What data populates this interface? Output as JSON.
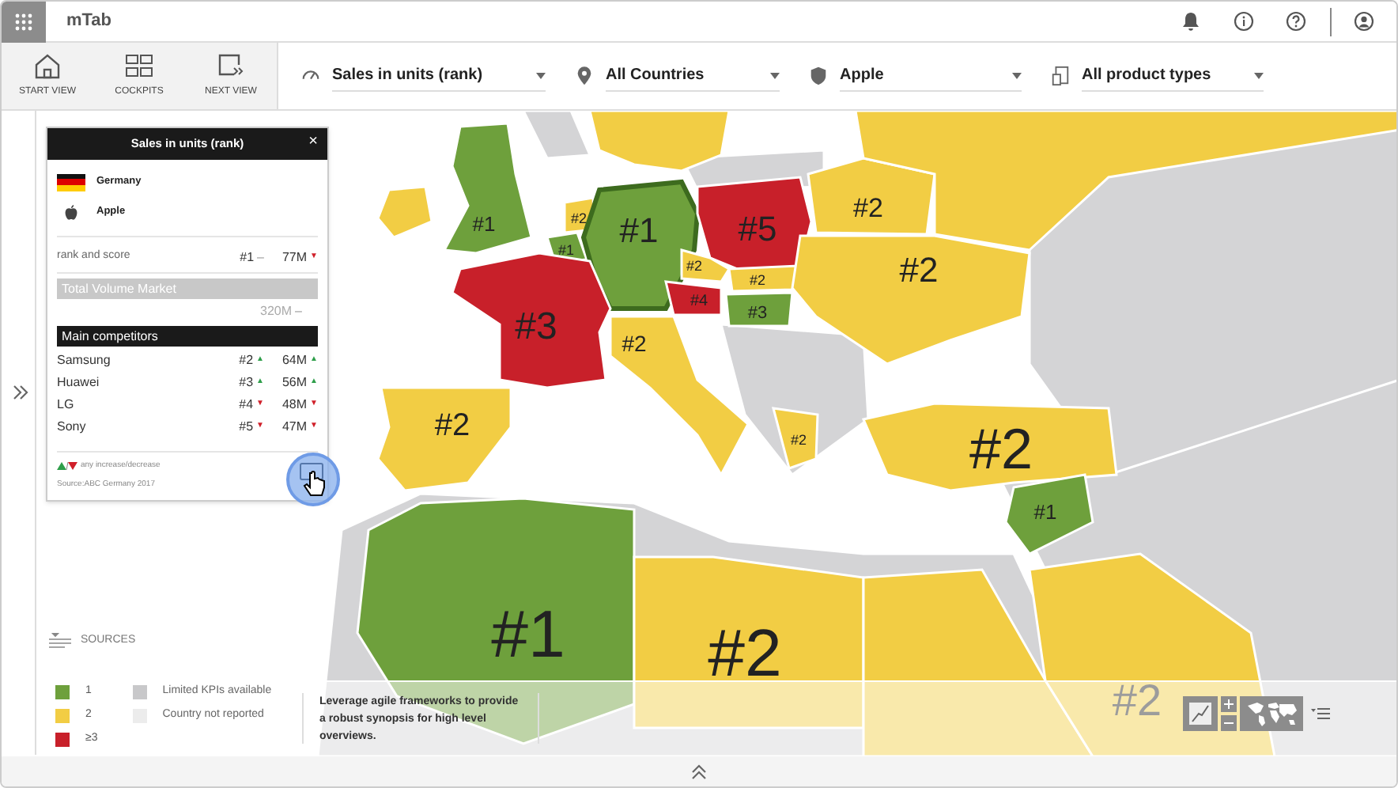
{
  "app": {
    "title": "mTab"
  },
  "views": [
    {
      "label": "START VIEW",
      "kind": "home"
    },
    {
      "label": "COCKPITS",
      "kind": "grid"
    },
    {
      "label": "NEXT VIEW",
      "kind": "next"
    }
  ],
  "filters": [
    {
      "label": "Sales in units (rank)",
      "kind": "gauge"
    },
    {
      "label": "All Countries",
      "kind": "pin"
    },
    {
      "label": "Apple",
      "kind": "shield"
    },
    {
      "label": "All product types",
      "kind": "product"
    }
  ],
  "info_panel": {
    "title": "Sales in units (rank)",
    "close": "×",
    "country": "Germany",
    "brand": "Apple",
    "score": {
      "label": "rank and score",
      "rank": "#1",
      "rank_trend": {
        "kind": "flat",
        "symbol": "–"
      },
      "value": "77M",
      "value_trend": {
        "kind": "down",
        "symbol": "▼"
      }
    },
    "total": {
      "label": "Total Volume Market",
      "value": "320M",
      "value_trend": {
        "kind": "flat",
        "symbol": "–"
      }
    },
    "competitors_title": "Main competitors",
    "competitors": [
      {
        "name": "Samsung",
        "rank": "#2",
        "rank_trend": {
          "kind": "up",
          "symbol": "▲"
        },
        "value": "64M",
        "value_trend": {
          "kind": "up",
          "symbol": "▲"
        }
      },
      {
        "name": "Huawei",
        "rank": "#3",
        "rank_trend": {
          "kind": "up",
          "symbol": "▲"
        },
        "value": "56M",
        "value_trend": {
          "kind": "up",
          "symbol": "▲"
        }
      },
      {
        "name": "LG",
        "rank": "#4",
        "rank_trend": {
          "kind": "down",
          "symbol": "▼"
        },
        "value": "48M",
        "value_trend": {
          "kind": "down",
          "symbol": "▼"
        }
      },
      {
        "name": "Sony",
        "rank": "#5",
        "rank_trend": {
          "kind": "down",
          "symbol": "▼"
        },
        "value": "47M",
        "value_trend": {
          "kind": "down",
          "symbol": "▼"
        }
      }
    ],
    "footnote": "any increase/decrease",
    "source": "Source:ABC Germany 2017"
  },
  "map": {
    "regions": [
      {
        "label": "#1",
        "color": "#6ea03c",
        "selected": false
      },
      {
        "color": "#f2cd44",
        "selected": false
      },
      {
        "color": "#f2cd44",
        "selected": false
      },
      {
        "label": "#2",
        "color": "#f2cd44",
        "selected": false
      },
      {
        "label": "#1",
        "color": "#6ea03c",
        "selected": false
      },
      {
        "label": "#1",
        "color": "#6ea03c",
        "selected": true
      },
      {
        "label": "#5",
        "color": "#c8202a",
        "selected": false
      },
      {
        "label": "#2",
        "color": "#f2cd44",
        "selected": false
      },
      {
        "label": "#2",
        "color": "#f2cd44",
        "selected": false
      },
      {
        "label": "#4",
        "color": "#c8202a",
        "selected": false
      },
      {
        "label": "#3",
        "color": "#6ea03c",
        "selected": false
      },
      {
        "label": "#3",
        "color": "#c8202a",
        "selected": false
      },
      {
        "label": "#2",
        "color": "#f2cd44",
        "selected": false
      },
      {
        "label": "#2",
        "color": "#f2cd44",
        "selected": false
      },
      {
        "label": "#2",
        "color": "#f2cd44",
        "selected": false
      },
      {
        "label": "#2",
        "color": "#f2cd44",
        "selected": false
      },
      {
        "label": "#2",
        "color": "#f2cd44",
        "selected": false
      },
      {
        "color": "#f2cd44",
        "selected": false
      },
      {
        "label": "#2",
        "color": "#f2cd44",
        "selected": false
      },
      {
        "label": "#1",
        "color": "#6ea03c",
        "selected": false
      },
      {
        "label": "#1",
        "color": "#6ea03c",
        "selected": false
      },
      {
        "label": "#2",
        "color": "#f2cd44",
        "selected": false
      },
      {
        "color": "#f2cd44",
        "selected": false
      },
      {
        "label": "#2",
        "color": "#f2cd44",
        "selected": false
      }
    ]
  },
  "legend": {
    "title": "SOURCES",
    "ranks": [
      {
        "label": "1",
        "color": "#6ea03c"
      },
      {
        "label": "2",
        "color": "#f2cd44"
      },
      {
        "label": "≥3",
        "color": "#c8202a"
      }
    ],
    "coverage": [
      {
        "label": "Limited KPIs available",
        "color": "#c8c8ca"
      },
      {
        "label": "Country not reported",
        "color": "#ececec"
      }
    ]
  },
  "note": "Leverage agile frameworks to provide a robust synopsis for high level overviews."
}
